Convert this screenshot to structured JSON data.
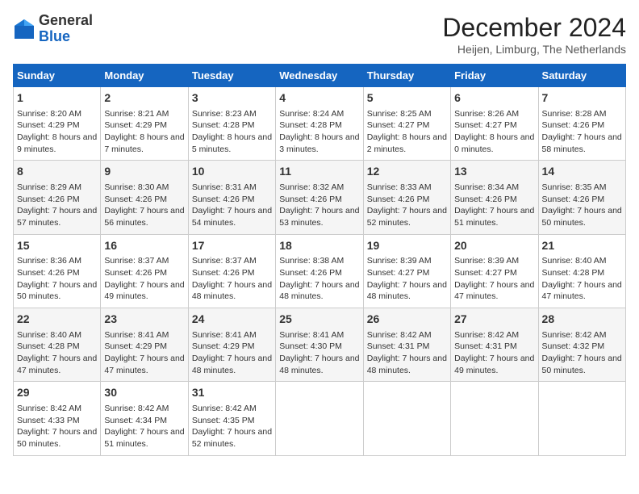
{
  "header": {
    "logo_general": "General",
    "logo_blue": "Blue",
    "month_title": "December 2024",
    "location": "Heijen, Limburg, The Netherlands"
  },
  "weekdays": [
    "Sunday",
    "Monday",
    "Tuesday",
    "Wednesday",
    "Thursday",
    "Friday",
    "Saturday"
  ],
  "weeks": [
    [
      {
        "day": "1",
        "sunrise": "8:20 AM",
        "sunset": "4:29 PM",
        "daylight": "8 hours and 9 minutes."
      },
      {
        "day": "2",
        "sunrise": "8:21 AM",
        "sunset": "4:29 PM",
        "daylight": "8 hours and 7 minutes."
      },
      {
        "day": "3",
        "sunrise": "8:23 AM",
        "sunset": "4:28 PM",
        "daylight": "8 hours and 5 minutes."
      },
      {
        "day": "4",
        "sunrise": "8:24 AM",
        "sunset": "4:28 PM",
        "daylight": "8 hours and 3 minutes."
      },
      {
        "day": "5",
        "sunrise": "8:25 AM",
        "sunset": "4:27 PM",
        "daylight": "8 hours and 2 minutes."
      },
      {
        "day": "6",
        "sunrise": "8:26 AM",
        "sunset": "4:27 PM",
        "daylight": "8 hours and 0 minutes."
      },
      {
        "day": "7",
        "sunrise": "8:28 AM",
        "sunset": "4:26 PM",
        "daylight": "7 hours and 58 minutes."
      }
    ],
    [
      {
        "day": "8",
        "sunrise": "8:29 AM",
        "sunset": "4:26 PM",
        "daylight": "7 hours and 57 minutes."
      },
      {
        "day": "9",
        "sunrise": "8:30 AM",
        "sunset": "4:26 PM",
        "daylight": "7 hours and 56 minutes."
      },
      {
        "day": "10",
        "sunrise": "8:31 AM",
        "sunset": "4:26 PM",
        "daylight": "7 hours and 54 minutes."
      },
      {
        "day": "11",
        "sunrise": "8:32 AM",
        "sunset": "4:26 PM",
        "daylight": "7 hours and 53 minutes."
      },
      {
        "day": "12",
        "sunrise": "8:33 AM",
        "sunset": "4:26 PM",
        "daylight": "7 hours and 52 minutes."
      },
      {
        "day": "13",
        "sunrise": "8:34 AM",
        "sunset": "4:26 PM",
        "daylight": "7 hours and 51 minutes."
      },
      {
        "day": "14",
        "sunrise": "8:35 AM",
        "sunset": "4:26 PM",
        "daylight": "7 hours and 50 minutes."
      }
    ],
    [
      {
        "day": "15",
        "sunrise": "8:36 AM",
        "sunset": "4:26 PM",
        "daylight": "7 hours and 50 minutes."
      },
      {
        "day": "16",
        "sunrise": "8:37 AM",
        "sunset": "4:26 PM",
        "daylight": "7 hours and 49 minutes."
      },
      {
        "day": "17",
        "sunrise": "8:37 AM",
        "sunset": "4:26 PM",
        "daylight": "7 hours and 48 minutes."
      },
      {
        "day": "18",
        "sunrise": "8:38 AM",
        "sunset": "4:26 PM",
        "daylight": "7 hours and 48 minutes."
      },
      {
        "day": "19",
        "sunrise": "8:39 AM",
        "sunset": "4:27 PM",
        "daylight": "7 hours and 48 minutes."
      },
      {
        "day": "20",
        "sunrise": "8:39 AM",
        "sunset": "4:27 PM",
        "daylight": "7 hours and 47 minutes."
      },
      {
        "day": "21",
        "sunrise": "8:40 AM",
        "sunset": "4:28 PM",
        "daylight": "7 hours and 47 minutes."
      }
    ],
    [
      {
        "day": "22",
        "sunrise": "8:40 AM",
        "sunset": "4:28 PM",
        "daylight": "7 hours and 47 minutes."
      },
      {
        "day": "23",
        "sunrise": "8:41 AM",
        "sunset": "4:29 PM",
        "daylight": "7 hours and 47 minutes."
      },
      {
        "day": "24",
        "sunrise": "8:41 AM",
        "sunset": "4:29 PM",
        "daylight": "7 hours and 48 minutes."
      },
      {
        "day": "25",
        "sunrise": "8:41 AM",
        "sunset": "4:30 PM",
        "daylight": "7 hours and 48 minutes."
      },
      {
        "day": "26",
        "sunrise": "8:42 AM",
        "sunset": "4:31 PM",
        "daylight": "7 hours and 48 minutes."
      },
      {
        "day": "27",
        "sunrise": "8:42 AM",
        "sunset": "4:31 PM",
        "daylight": "7 hours and 49 minutes."
      },
      {
        "day": "28",
        "sunrise": "8:42 AM",
        "sunset": "4:32 PM",
        "daylight": "7 hours and 50 minutes."
      }
    ],
    [
      {
        "day": "29",
        "sunrise": "8:42 AM",
        "sunset": "4:33 PM",
        "daylight": "7 hours and 50 minutes."
      },
      {
        "day": "30",
        "sunrise": "8:42 AM",
        "sunset": "4:34 PM",
        "daylight": "7 hours and 51 minutes."
      },
      {
        "day": "31",
        "sunrise": "8:42 AM",
        "sunset": "4:35 PM",
        "daylight": "7 hours and 52 minutes."
      },
      null,
      null,
      null,
      null
    ]
  ],
  "labels": {
    "sunrise": "Sunrise:",
    "sunset": "Sunset:",
    "daylight": "Daylight:"
  }
}
